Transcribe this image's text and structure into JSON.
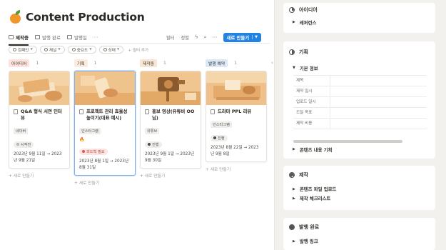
{
  "page": {
    "title": "Content Production",
    "icon": "tangerine-icon"
  },
  "tabs": [
    {
      "label": "제작중",
      "active": true
    },
    {
      "label": "발행 완료",
      "active": false
    },
    {
      "label": "발행일",
      "active": false
    }
  ],
  "toolbar": {
    "filter": "필터",
    "sort": "정렬",
    "new_button": "새로 만들기"
  },
  "filters": {
    "chips": [
      "컴패인",
      "채널",
      "중요도",
      "상태"
    ],
    "add": "+ 필터 추가"
  },
  "columns": [
    {
      "tag": "아이디어",
      "count": "1",
      "tag_color": "#fde2dd",
      "card": {
        "title": "Q&A 형식 서면 인터뷰",
        "badge": "네이버",
        "status": "시작전",
        "status_color": "#b7b5b0",
        "fire": "",
        "dates": "2023년 9월 11일 → 2023년 9월 21일"
      }
    },
    {
      "tag": "기획",
      "count": "1",
      "tag_color": "#fbecdd",
      "card": {
        "title": "프로젝트 관리 효율성 높이기(대표 예시)",
        "badge": "인스타그램",
        "status": "피드백 필요",
        "status_color": "#e0574a",
        "fire": "🔥",
        "dates": "2023년 8월 1일 → 2023년 8월 31일"
      }
    },
    {
      "tag": "제작중",
      "count": "1",
      "tag_color": "#f6e6d2",
      "card": {
        "title": "홍보 영상(유튜버 OO님)",
        "badge": "유튜브",
        "status": "진행",
        "status_color": "#4a4843",
        "fire": "",
        "dates": "2023년 9월 1일 → 2023년 9월 30일"
      }
    },
    {
      "tag": "발행 예약",
      "count": "1",
      "tag_color": "#dbe8f5",
      "card": {
        "title": "드라마 PPL 리뷰",
        "badge": "인스타그램",
        "status": "진행",
        "status_color": "#4a4843",
        "fire": "",
        "dates": "2023년 8월 22일 → 2023년 9월 8일"
      }
    }
  ],
  "new_item": "+ 새로 만들기",
  "panel": {
    "idea": {
      "title": "아이디어",
      "toggle": "레퍼런스"
    },
    "plan": {
      "title": "기획",
      "basic": "기본 정보",
      "rows": [
        "제목",
        "제작 일시",
        "업로드 일시",
        "도달 목표",
        "제작 비용"
      ],
      "content": "콘텐츠 내용 기획"
    },
    "production": {
      "title": "제작",
      "items": [
        "콘텐츠 파일 업로드",
        "제작 체크리스트"
      ]
    },
    "publish": {
      "title": "발행 완료",
      "toggle": "발행 링크"
    }
  }
}
